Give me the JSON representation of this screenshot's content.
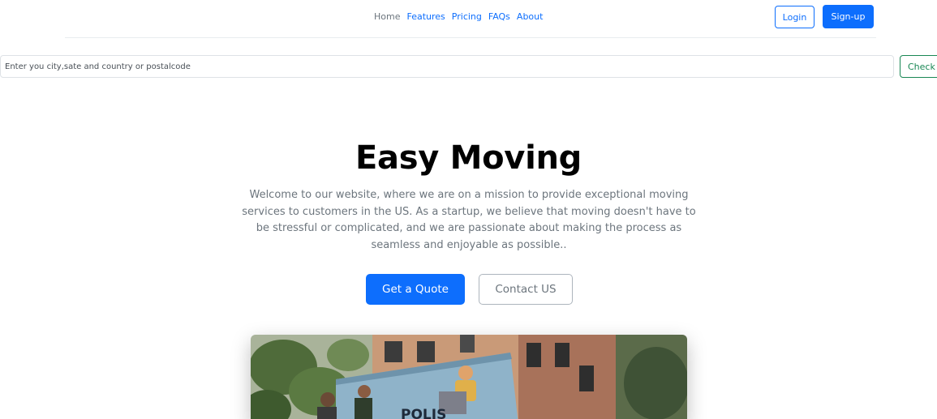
{
  "nav": {
    "links": [
      "Home",
      "Features",
      "Pricing",
      "FAQs",
      "About"
    ],
    "login_label": "Login",
    "signup_label": "Sign-up"
  },
  "search": {
    "placeholder": "Enter you city,sate and country or postalcode",
    "button_label": "Check"
  },
  "hero": {
    "title": "Easy Moving",
    "description": "Welcome to our website, where we are on a mission to provide exceptional moving services to customers in the US. As a startup, we believe that moving doesn't have to be stressful or complicated, and we are passionate about making the process as seamless and enjoyable as possible..",
    "primary_button": "Get a Quote",
    "secondary_button": "Contact US",
    "image_text": "POLIS"
  },
  "colors": {
    "primary": "#0d6efd",
    "success": "#198754",
    "muted": "#6c757d"
  }
}
